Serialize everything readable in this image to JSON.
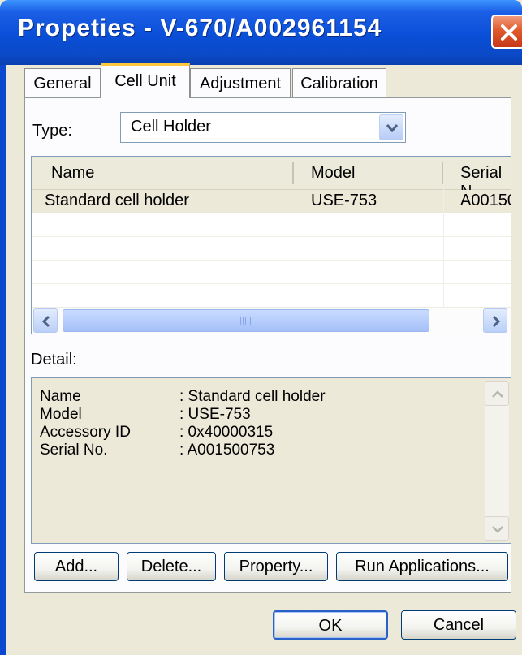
{
  "window": {
    "title": "Propeties - V-670/A002961154"
  },
  "tabs": [
    {
      "label": "General"
    },
    {
      "label": "Cell Unit"
    },
    {
      "label": "Adjustment"
    },
    {
      "label": "Calibration"
    }
  ],
  "type_field": {
    "label": "Type:",
    "value": "Cell Holder"
  },
  "list": {
    "columns": [
      "Name",
      "Model",
      "Serial N"
    ],
    "rows": [
      {
        "name": "Standard cell holder",
        "model": "USE-753",
        "serial": "A00150"
      }
    ]
  },
  "detail": {
    "label": "Detail:",
    "fields": [
      {
        "key": "Name",
        "value": ": Standard cell holder"
      },
      {
        "key": "Model",
        "value": ": USE-753"
      },
      {
        "key": "Accessory ID",
        "value": ": 0x40000315"
      },
      {
        "key": "Serial No.",
        "value": ": A001500753"
      }
    ]
  },
  "buttons": {
    "add": "Add...",
    "delete": "Delete...",
    "property": "Property...",
    "run": "Run Applications...",
    "ok": "OK",
    "cancel": "Cancel"
  },
  "icons": {
    "close": "close-icon",
    "dropdown": "chevron-down-icon",
    "scroll_left": "arrow-left-icon",
    "scroll_right": "arrow-right-icon",
    "scroll_up": "arrow-up-icon",
    "scroll_down": "arrow-down-icon"
  },
  "colors": {
    "titlebar": "#0a4fd8",
    "active_tab_accent": "#ffc83c",
    "dialog_bg": "#ece9d8"
  }
}
